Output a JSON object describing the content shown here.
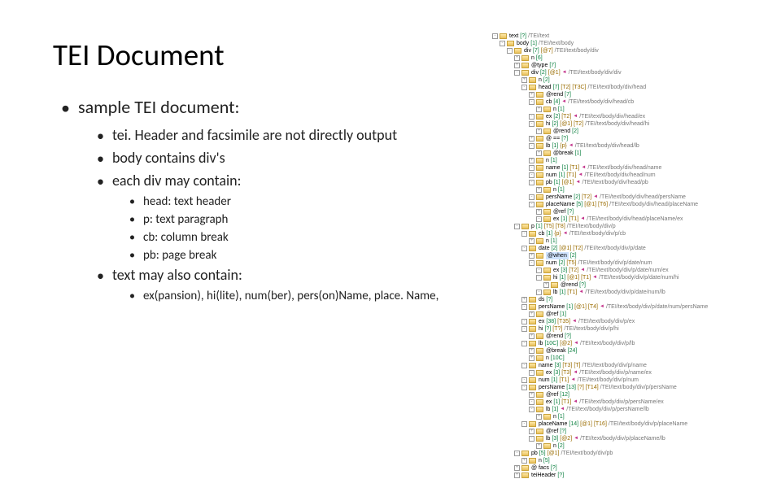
{
  "title": "TEI Document",
  "bullets": {
    "b1": "sample TEI document:",
    "b2a": "tei. Header and facsimile are not directly output",
    "b2b": "body contains div's",
    "b2c": "each div may contain:",
    "b3a": "head: text header",
    "b3b": "p: text paragraph",
    "b3c": "cb: column break",
    "b3d": "pb: page break",
    "b2d": "text may also contain:",
    "b3e": "ex(pansion), hi(lite), num(ber), pers(on)Name, place. Name,"
  },
  "tree": [
    {
      "d": 0,
      "b": "-",
      "e": "text",
      "c": "[?]",
      "x": "/TEI/text"
    },
    {
      "d": 1,
      "b": "-",
      "e": "body",
      "c": "[1]",
      "x": "/TEI/text/body"
    },
    {
      "d": 2,
      "b": "-",
      "e": "div",
      "c": "[7]",
      "a": "[@7]",
      "x": "/TEI/text/body/div"
    },
    {
      "d": 3,
      "b": "+",
      "e": "n",
      "c": "[6]"
    },
    {
      "d": 3,
      "b": "+",
      "e": "@type",
      "c": "[7]"
    },
    {
      "d": 3,
      "b": "-",
      "e": "div",
      "c": "[2]",
      "a": "[@1]",
      "ar": "◄",
      "x": "/TEI/text/body/div/div"
    },
    {
      "d": 4,
      "b": "+",
      "e": "n",
      "c": "[2]"
    },
    {
      "d": 4,
      "b": "-",
      "e": "head",
      "c": "[7]",
      "a": "[T2] [T3C]",
      "x": "/TEI/text/body/div/head"
    },
    {
      "d": 5,
      "b": "+",
      "e": "@rend",
      "c": "[7]"
    },
    {
      "d": 5,
      "b": "-",
      "e": "cb",
      "c": "[4]",
      "ar": "◄",
      "x": "/TEI/text/body/div/head/cb"
    },
    {
      "d": 6,
      "b": "+",
      "e": "n",
      "c": "[1]"
    },
    {
      "d": 5,
      "b": "-",
      "e": "ex",
      "c": "[2]",
      "a": "[T2]",
      "ar": "◄",
      "x": "/TEI/text/body/div/head/ex"
    },
    {
      "d": 5,
      "b": "-",
      "e": "hi",
      "c": "[2]",
      "a": "[@1] [T2]",
      "x": "/TEI/text/body/div/head/hi"
    },
    {
      "d": 6,
      "b": "+",
      "e": "@rend",
      "c": "[2]"
    },
    {
      "d": 5,
      "b": "+",
      "e": "@ ==",
      "c": "[?]"
    },
    {
      "d": 5,
      "b": "-",
      "e": "lb",
      "c": "[1]",
      "a": "{p}",
      "ar": "◄",
      "x": "/TEI/text/body/div/head/lb"
    },
    {
      "d": 6,
      "b": "+",
      "e": "@break",
      "c": "[1]"
    },
    {
      "d": 5,
      "b": "+",
      "e": "n",
      "c": "[1]"
    },
    {
      "d": 5,
      "b": "-",
      "e": "name",
      "c": "[1]",
      "a": "[T1]",
      "ar": "◄",
      "x": "/TEI/text/body/div/head/name"
    },
    {
      "d": 5,
      "b": "-",
      "e": "num",
      "c": "[1]",
      "a": "[T1]",
      "ar": "◄",
      "x": "/TEI/text/body/div/head/num"
    },
    {
      "d": 5,
      "b": "-",
      "e": "pb",
      "c": "[1]",
      "a": "[@1]",
      "ar": "◄",
      "x": "/TEI/text/body/div/head/pb"
    },
    {
      "d": 6,
      "b": "+",
      "e": "n",
      "c": "[1]"
    },
    {
      "d": 5,
      "b": "-",
      "e": "persName",
      "c": "[2]",
      "a": "[T2]",
      "ar": "◄",
      "x": "/TEI/text/body/div/head/persName"
    },
    {
      "d": 5,
      "b": "-",
      "e": "placeName",
      "c": "[5]",
      "a": "[@1] [T6]",
      "x": "/TEI/text/body/div/head/placeName"
    },
    {
      "d": 6,
      "b": "+",
      "e": "@ref",
      "c": "[?]"
    },
    {
      "d": 6,
      "b": "-",
      "e": "ex",
      "c": "[1]",
      "a": "[T1]",
      "ar": "◄",
      "x": "/TEI/text/body/div/head/placeName/ex"
    },
    {
      "d": 3,
      "b": "-",
      "e": "p",
      "c": "[1]",
      "a": "[T5] [T8]",
      "x": "/TEI/text/body/div/p"
    },
    {
      "d": 4,
      "b": "-",
      "e": "cb",
      "c": "[1]",
      "a": "{p}",
      "ar": "◄",
      "x": "/TEI/text/body/div/p/cb"
    },
    {
      "d": 5,
      "b": "+",
      "e": "n",
      "c": "[1]"
    },
    {
      "d": 4,
      "b": "-",
      "e": "date",
      "c": "[2]",
      "a": "[@1] [T2]",
      "x": "/TEI/text/body/div/p/date"
    },
    {
      "d": 5,
      "b": "+",
      "e": "@when",
      "c": "[2]",
      "sel": true
    },
    {
      "d": 5,
      "b": "-",
      "e": "num",
      "c": "[2]",
      "a": "[T5]",
      "x": "/TEI/text/body/div/p/date/num"
    },
    {
      "d": 6,
      "b": "-",
      "e": "ex",
      "c": "[3]",
      "a": "[T2]",
      "ar": "◄",
      "x": "/TEI/text/body/div/p/date/num/ex"
    },
    {
      "d": 6,
      "b": "-",
      "e": "hi",
      "c": "[1]",
      "a": "[@1] [T1]",
      "ar": "◄",
      "x": "/TEI/text/body/div/p/date/num/hi"
    },
    {
      "d": 7,
      "b": "+",
      "e": "@rend",
      "c": "[?]"
    },
    {
      "d": 6,
      "b": "-",
      "e": "lb",
      "c": "[1]",
      "a": "[T1]",
      "ar": "◄",
      "x": "/TEI/text/body/div/p/date/num/lb"
    },
    {
      "d": 4,
      "b": "+",
      "e": "ds",
      "c": "[?]"
    },
    {
      "d": 4,
      "b": "-",
      "e": "persName",
      "c": "[1]",
      "a": "[@1] [T4]",
      "ar": "◄",
      "x": "/TEI/text/body/div/p/date/num/persName"
    },
    {
      "d": 5,
      "b": "+",
      "e": "@ref",
      "c": "[1]"
    },
    {
      "d": 4,
      "b": "-",
      "e": "ex",
      "c": "[38]",
      "a": "[T35]",
      "ar": "◄",
      "x": "/TEI/text/body/div/p/ex"
    },
    {
      "d": 4,
      "b": "-",
      "e": "hi",
      "c": "[?]",
      "a": "[T?]",
      "x": "/TEI/text/body/div/p/hi"
    },
    {
      "d": 5,
      "b": "+",
      "e": "@rend",
      "c": "[?]"
    },
    {
      "d": 4,
      "b": "-",
      "e": "lb",
      "c": "[10C]",
      "a": "[@2]",
      "ar": "◄",
      "x": "/TEI/text/body/div/p/lb"
    },
    {
      "d": 5,
      "b": "+",
      "e": "@break",
      "c": "[24]"
    },
    {
      "d": 5,
      "b": "+",
      "e": "n",
      "c": "[10C]"
    },
    {
      "d": 4,
      "b": "-",
      "e": "name",
      "c": "[3]",
      "a": "[T3] [T]",
      "x": "/TEI/text/body/div/p/name"
    },
    {
      "d": 5,
      "b": "-",
      "e": "ex",
      "c": "[3]",
      "a": "[T3]",
      "ar": "◄",
      "x": "/TEI/text/body/div/p/name/ex"
    },
    {
      "d": 4,
      "b": "-",
      "e": "num",
      "c": "[1]",
      "a": "[T1]",
      "ar": "◄",
      "x": "/TEI/text/body/div/p/num"
    },
    {
      "d": 4,
      "b": "-",
      "e": "persName",
      "c": "[13]",
      "a": "[?] [T14]",
      "x": "/TEI/text/body/div/p/persName"
    },
    {
      "d": 5,
      "b": "+",
      "e": "@ref",
      "c": "[12]"
    },
    {
      "d": 5,
      "b": "-",
      "e": "ex",
      "c": "[1]",
      "a": "[T1]",
      "ar": "◄",
      "x": "/TEI/text/body/div/p/persName/ex"
    },
    {
      "d": 5,
      "b": "-",
      "e": "lb",
      "c": "[1]",
      "ar": "◄",
      "x": "/TEI/text/body/div/p/persName/lb"
    },
    {
      "d": 6,
      "b": "+",
      "e": "n",
      "c": "[1]"
    },
    {
      "d": 4,
      "b": "-",
      "e": "placeName",
      "c": "[14]",
      "a": "[@1] [T16]",
      "x": "/TEI/text/body/div/p/placeName"
    },
    {
      "d": 5,
      "b": "+",
      "e": "@ref",
      "c": "[?]"
    },
    {
      "d": 5,
      "b": "-",
      "e": "lb",
      "c": "[3]",
      "a": "[@2]",
      "ar": "◄",
      "x": "/TEI/text/body/div/p/placeName/lb"
    },
    {
      "d": 6,
      "b": "+",
      "e": "n",
      "c": "[2]"
    },
    {
      "d": 3,
      "b": "-",
      "e": "pb",
      "c": "[5]",
      "a": "[@1]",
      "x": "/TEI/text/body/div/pb"
    },
    {
      "d": 4,
      "b": "+",
      "e": "n",
      "c": "[5]"
    },
    {
      "d": 3,
      "b": "+",
      "e": "@ facs",
      "c": "[?]"
    },
    {
      "d": 3,
      "b": "+",
      "e": "teiHeader",
      "c": "[?]"
    }
  ]
}
